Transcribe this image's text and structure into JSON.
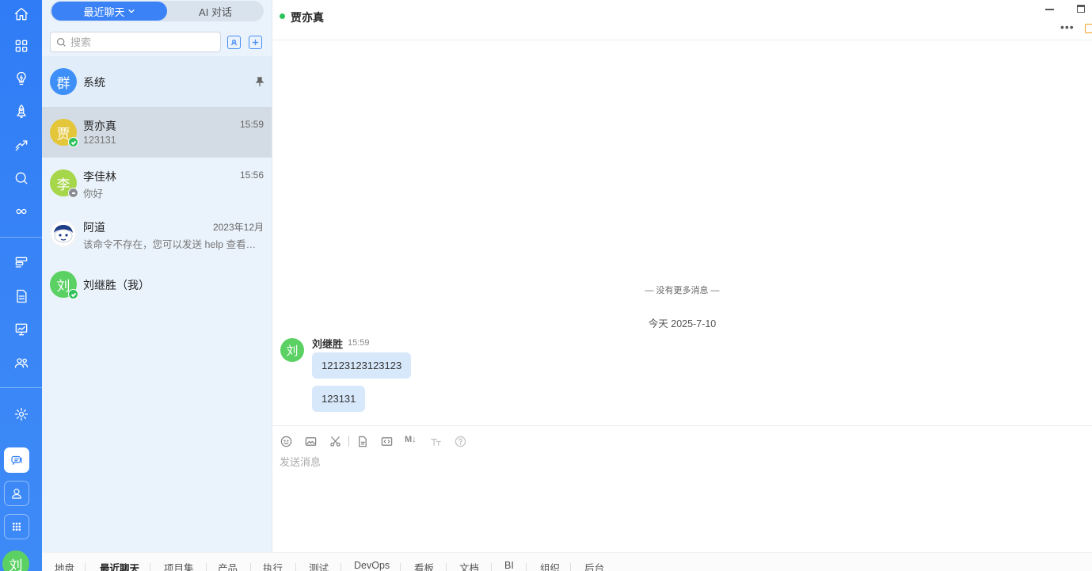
{
  "tabs": {
    "recent_label": "最近聊天",
    "ai_label": "AI 对话"
  },
  "search": {
    "placeholder": "搜索"
  },
  "conversations": [
    {
      "name": "系统",
      "avatar": "群",
      "avatar_color": "#3e8ff7",
      "time": "",
      "preview": "",
      "pinned": true
    },
    {
      "name": "贾亦真",
      "avatar": "贾",
      "avatar_color": "#e3c63a",
      "time": "15:59",
      "preview": "123131",
      "status": "online"
    },
    {
      "name": "李佳林",
      "avatar": "李",
      "avatar_color": "#a6d64a",
      "time": "15:56",
      "preview": "你好",
      "status": "away"
    },
    {
      "name": "阿道",
      "avatar": "bot",
      "time": "2023年12月",
      "preview": "该命令不存在，您可以发送 help 查看命令帮助"
    },
    {
      "name": "刘继胜（我）",
      "avatar": "刘",
      "avatar_color": "#5bd164",
      "status": "online"
    }
  ],
  "chat": {
    "title": "贾亦真",
    "no_more": "— 没有更多消息 —",
    "date": "今天 2025-7-10",
    "message": {
      "sender": "刘继胜",
      "avatar": "刘",
      "time": "15:59",
      "bubbles": [
        "12123123123123",
        "123131"
      ]
    },
    "composer_placeholder": "发送消息",
    "md_label": "M↓",
    "more_label": "•••"
  },
  "user": {
    "avatar": "刘"
  },
  "bottom_nav": [
    "地盘",
    "最近聊天",
    "项目集",
    "产品",
    "执行",
    "测试",
    "DevOps",
    "看板",
    "文档",
    "BI",
    "组织",
    "后台"
  ],
  "colors": {
    "accent": "#3b82f6",
    "rail": "#2f7cf6",
    "online": "#2ec25b",
    "bubble": "#d7e8fb"
  }
}
